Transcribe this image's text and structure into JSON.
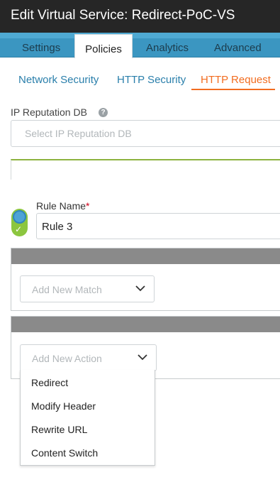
{
  "window": {
    "title": "Edit Virtual Service: Redirect-PoC-VS"
  },
  "tabs": [
    {
      "label": "Settings",
      "active": false
    },
    {
      "label": "Policies",
      "active": true
    },
    {
      "label": "Analytics",
      "active": false
    },
    {
      "label": "Advanced",
      "active": false
    }
  ],
  "subtabs": [
    {
      "label": "Network Security",
      "active": false
    },
    {
      "label": "HTTP Security",
      "active": false
    },
    {
      "label": "HTTP Request",
      "active": true
    }
  ],
  "ip_reputation": {
    "label": "IP Reputation DB",
    "help_icon": "question-circle-icon",
    "placeholder": "Select IP Reputation DB"
  },
  "rule": {
    "enabled": true,
    "name_label": "Rule Name",
    "required_marker": "*",
    "name_value": "Rule 3"
  },
  "match": {
    "placeholder": "Add New Match",
    "icon": "chevron-down-icon"
  },
  "action": {
    "placeholder": "Add New Action",
    "icon": "chevron-down-icon",
    "options": [
      "Redirect",
      "Modify Header",
      "Rewrite URL",
      "Content Switch"
    ]
  },
  "colors": {
    "titlebar": "#262626",
    "tabbar": "#3b96c1",
    "link": "#2a7fab",
    "active_subtab": "#f26d21",
    "toggle_on": "#8cc63f",
    "toggle_knob": "#4da3d6",
    "panel_header": "#8a8a8a"
  }
}
